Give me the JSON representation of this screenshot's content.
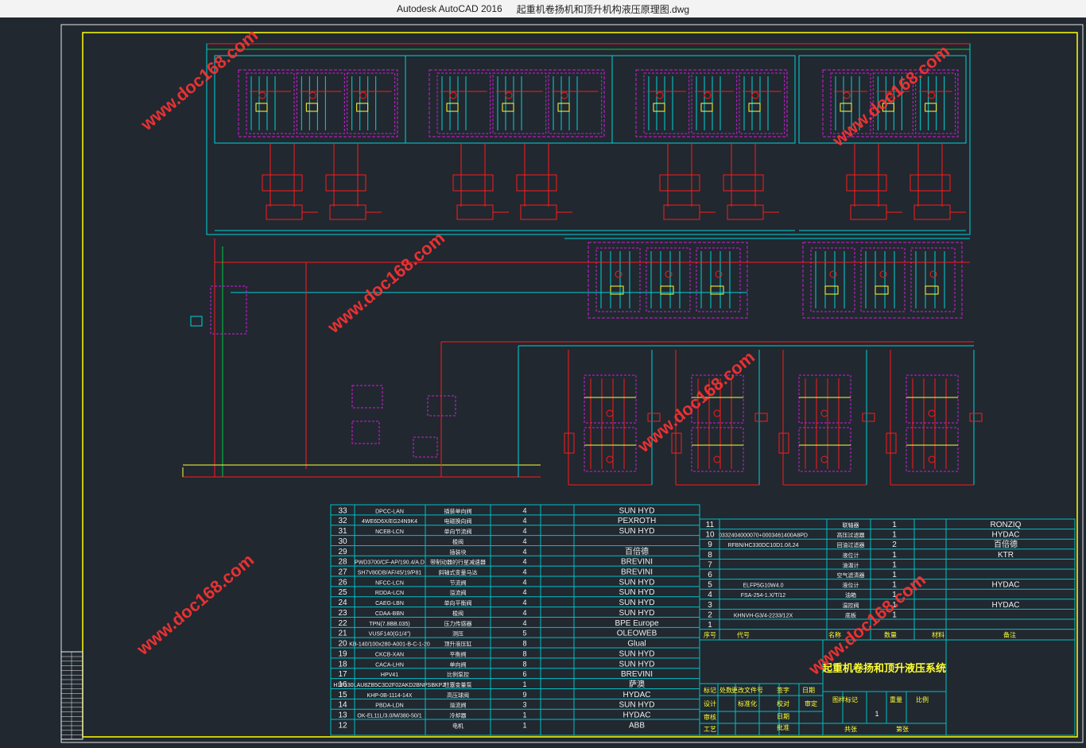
{
  "window": {
    "app_title": "Autodesk AutoCAD 2016",
    "file_name": "起重机卷扬机和顶升机构液压原理图.dwg"
  },
  "colors": {
    "background": "#212830",
    "frame_outer": "#e6e6e6",
    "frame_inner": "#ffff00",
    "pipe_cyan": "#00d5d8",
    "pipe_red": "#ff1a1a",
    "box_magenta": "#d31bd8",
    "table_cyan": "#00c0c4",
    "text_white": "#f0f0f0",
    "text_yellow": "#ffff33",
    "watermark": "#ff3333"
  },
  "watermark": {
    "text": "www.doc168.com"
  },
  "table_left": {
    "rows": [
      {
        "no": "33",
        "code": "DPCC-LAN",
        "name": "插装单向阀",
        "qty": "4",
        "maker": "SUN HYD"
      },
      {
        "no": "32",
        "code": "4WE6D6X/EG24N9K4",
        "name": "电磁换向阀",
        "qty": "4",
        "maker": "PEXROTH"
      },
      {
        "no": "31",
        "code": "NCEB-LCN",
        "name": "单向节流阀",
        "qty": "4",
        "maker": "SUN HYD"
      },
      {
        "no": "30",
        "code": "",
        "name": "梭阀",
        "qty": "4",
        "maker": ""
      },
      {
        "no": "29",
        "code": "",
        "name": "插装块",
        "qty": "4",
        "maker": "百倍德"
      },
      {
        "no": "28",
        "code": "PWD3700/CF-AP/190.4/A.D",
        "name": "带制动器的行星减速器",
        "qty": "4",
        "maker": "BREVINI"
      },
      {
        "no": "27",
        "code": "SH7V80DB/AF/45/19/P81",
        "name": "斜轴式变量马达",
        "qty": "4",
        "maker": "BREVINI"
      },
      {
        "no": "26",
        "code": "NFCC-LCN",
        "name": "节流阀",
        "qty": "4",
        "maker": "SUN HYD"
      },
      {
        "no": "25",
        "code": "RDDA-LCN",
        "name": "溢流阀",
        "qty": "4",
        "maker": "SUN HYD"
      },
      {
        "no": "24",
        "code": "CAEG-LBN",
        "name": "单向平衡阀",
        "qty": "4",
        "maker": "SUN HYD"
      },
      {
        "no": "23",
        "code": "CDAA-BBN",
        "name": "梭阀",
        "qty": "4",
        "maker": "SUN HYD"
      },
      {
        "no": "22",
        "code": "TPN(7.8BB.035)",
        "name": "压力传感器",
        "qty": "4",
        "maker": "BPE Europe"
      },
      {
        "no": "21",
        "code": "VUSF140(G1/4\")",
        "name": "测压",
        "qty": "5",
        "maker": "OLEOWEB"
      },
      {
        "no": "20",
        "code": "KB-140/100x280-A001-B-C-1-20",
        "name": "顶升液压缸",
        "qty": "8",
        "maker": "Glual"
      },
      {
        "no": "19",
        "code": "CKCB-XAN",
        "name": "平衡阀",
        "qty": "8",
        "maker": "SUN HYD"
      },
      {
        "no": "18",
        "code": "CACA-LHN",
        "name": "单向阀",
        "qty": "8",
        "maker": "SUN HYD"
      },
      {
        "no": "17",
        "code": "HPV41",
        "name": "比例泵控",
        "qty": "6",
        "maker": "BREVINI"
      },
      {
        "no": "16",
        "code": "H1P130LAU8ZB5C3D2F02AKD2BNPSBKPZ",
        "name": "柱塞变量泵",
        "qty": "1",
        "maker": "萨澳"
      },
      {
        "no": "15",
        "code": "KHP-0B-1114-14X",
        "name": "高压球阀",
        "qty": "9",
        "maker": "HYDAC"
      },
      {
        "no": "14",
        "code": "PBDA-LDN",
        "name": "溢流阀",
        "qty": "3",
        "maker": "SUN HYD"
      },
      {
        "no": "13",
        "code": "OK-EL11L/3.0/M/380-50/1",
        "name": "冷却器",
        "qty": "1",
        "maker": "HYDAC"
      },
      {
        "no": "12",
        "code": "",
        "name": "电机",
        "qty": "1",
        "maker": "ABB"
      }
    ]
  },
  "table_right": {
    "rows": [
      {
        "no": "11",
        "code": "",
        "name": "联轴器",
        "qty": "1",
        "maker": "RONZIQ"
      },
      {
        "no": "10",
        "code": "0332404000070+0003461400A8PD",
        "name": "高压过滤器",
        "qty": "1",
        "maker": "HYDAC"
      },
      {
        "no": "9",
        "code": "RFBN/HC330DC10D1.0/L24",
        "name": "回油过滤器",
        "qty": "2",
        "maker": "百倍德"
      },
      {
        "no": "8",
        "code": "",
        "name": "液位计",
        "qty": "1",
        "maker": "KTR"
      },
      {
        "no": "7",
        "code": "",
        "name": "油温计",
        "qty": "1",
        "maker": ""
      },
      {
        "no": "6",
        "code": "",
        "name": "空气滤清器",
        "qty": "1",
        "maker": ""
      },
      {
        "no": "5",
        "code": "ELFP5G10W4.0",
        "name": "液位计",
        "qty": "1",
        "maker": "HYDAC"
      },
      {
        "no": "4",
        "code": "FSA-254-1.X/T/12",
        "name": "油箱",
        "qty": "1",
        "maker": ""
      },
      {
        "no": "3",
        "code": "",
        "name": "温控阀",
        "qty": "1",
        "maker": "HYDAC"
      },
      {
        "no": "2",
        "code": "KHNVH-G3/4-2233/12X",
        "name": "底板",
        "qty": "1",
        "maker": ""
      },
      {
        "no": "1",
        "code": "",
        "name": "",
        "qty": "",
        "maker": ""
      }
    ],
    "header": [
      "序号",
      "代号",
      "名称",
      "数量",
      "材料",
      "备注"
    ]
  },
  "title_block": {
    "drawing_title": "起重机卷扬和顶升液压系统",
    "labels": {
      "mark": "标记",
      "count": "处数",
      "file_no": "更改文件号",
      "sign": "签字",
      "date": "日期",
      "design": "设计",
      "std": "标准化",
      "stage_mark": "图样标记",
      "weight": "重量",
      "scale": "比例",
      "review": "审核",
      "process": "工艺",
      "approve": "批准",
      "total": "共张",
      "sheet": "第张",
      "check": "校对",
      "audit": "审定",
      "date2": "日期"
    },
    "qty_value": "1"
  },
  "side_strip": {
    "labels": [
      "借",
      "通",
      "用",
      "件",
      "登",
      "记",
      "描",
      "图",
      "校",
      "对",
      "底",
      "图",
      "总",
      "号",
      "签",
      "字",
      "日",
      "期"
    ]
  }
}
